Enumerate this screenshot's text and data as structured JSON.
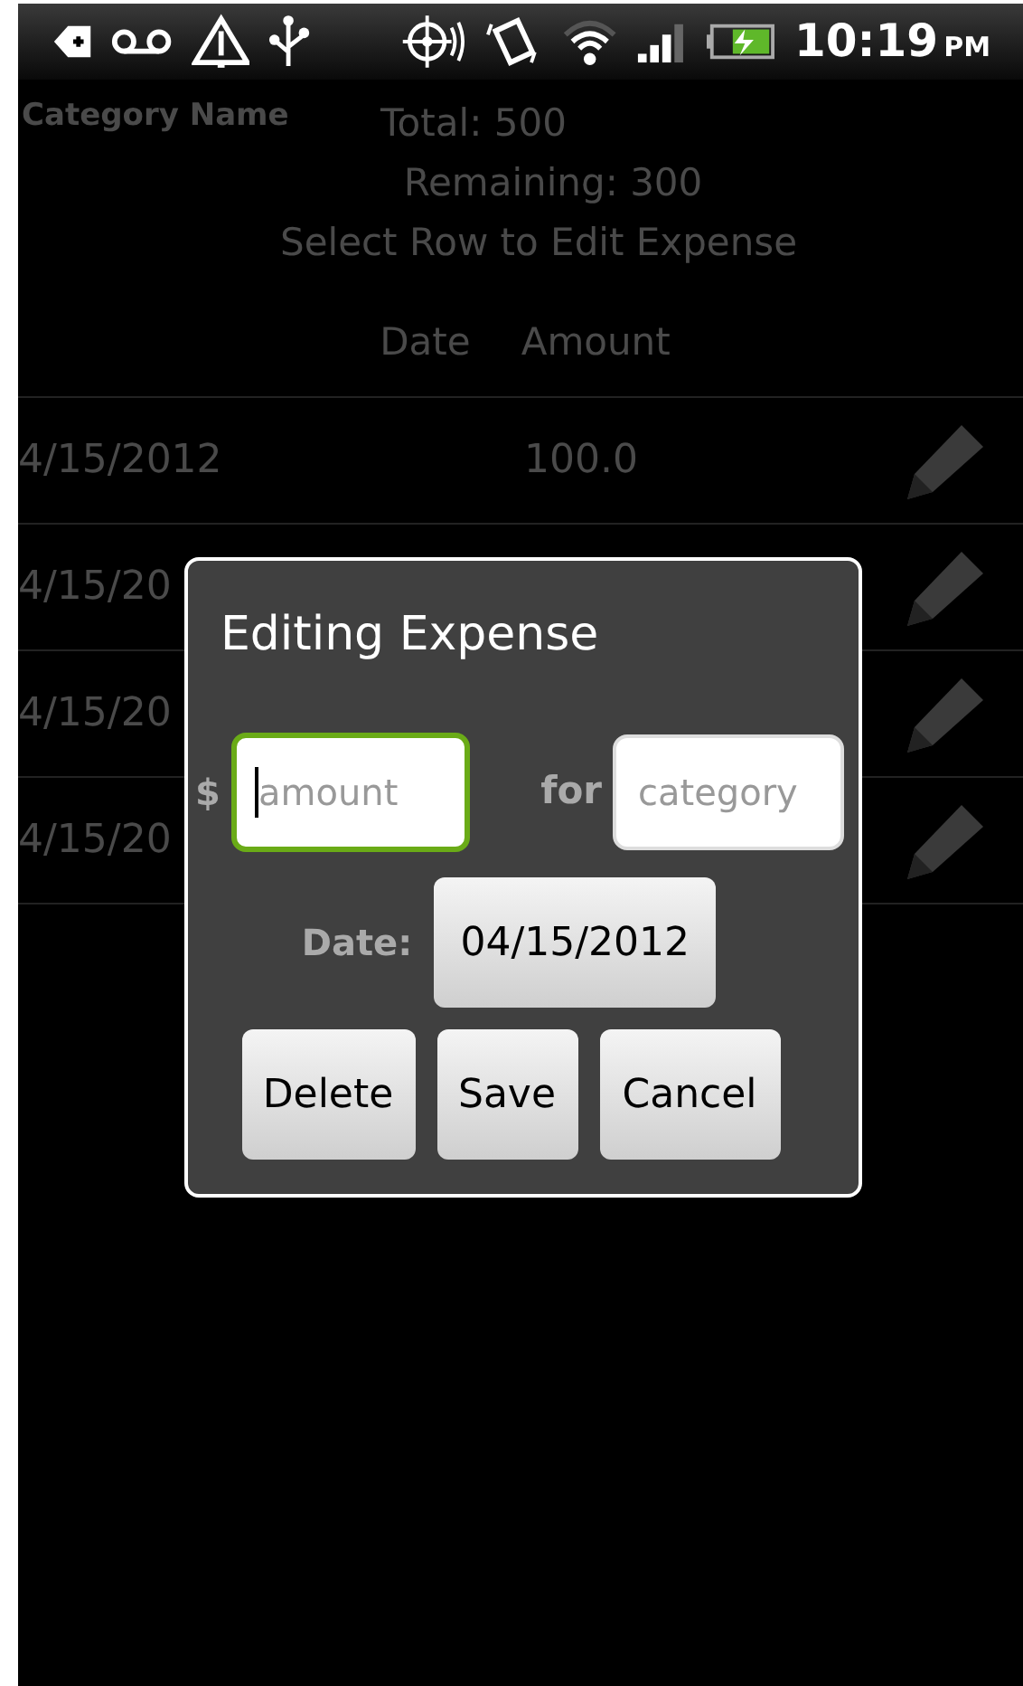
{
  "status_bar": {
    "time": "10:19",
    "am_pm": "PM"
  },
  "header": {
    "category_name": "Category Name",
    "total": "Total: 500",
    "remaining": "Remaining: 300",
    "hint": "Select Row to Edit Expense"
  },
  "table": {
    "columns": [
      "Date",
      "Amount"
    ],
    "rows": [
      {
        "date": "4/15/2012",
        "amount": "100.0"
      },
      {
        "date": "4/15/20"
      },
      {
        "date": "4/15/20"
      },
      {
        "date": "4/15/20"
      }
    ]
  },
  "dialog": {
    "title": "Editing Expense",
    "currency": "$",
    "amount_field": {
      "placeholder": "amount",
      "focused": true
    },
    "for_label": "for",
    "category_field": {
      "placeholder": "category",
      "focused": false
    },
    "date_label": "Date:",
    "date": "04/15/2012",
    "buttons": [
      "Delete",
      "Save",
      "Cancel"
    ]
  }
}
